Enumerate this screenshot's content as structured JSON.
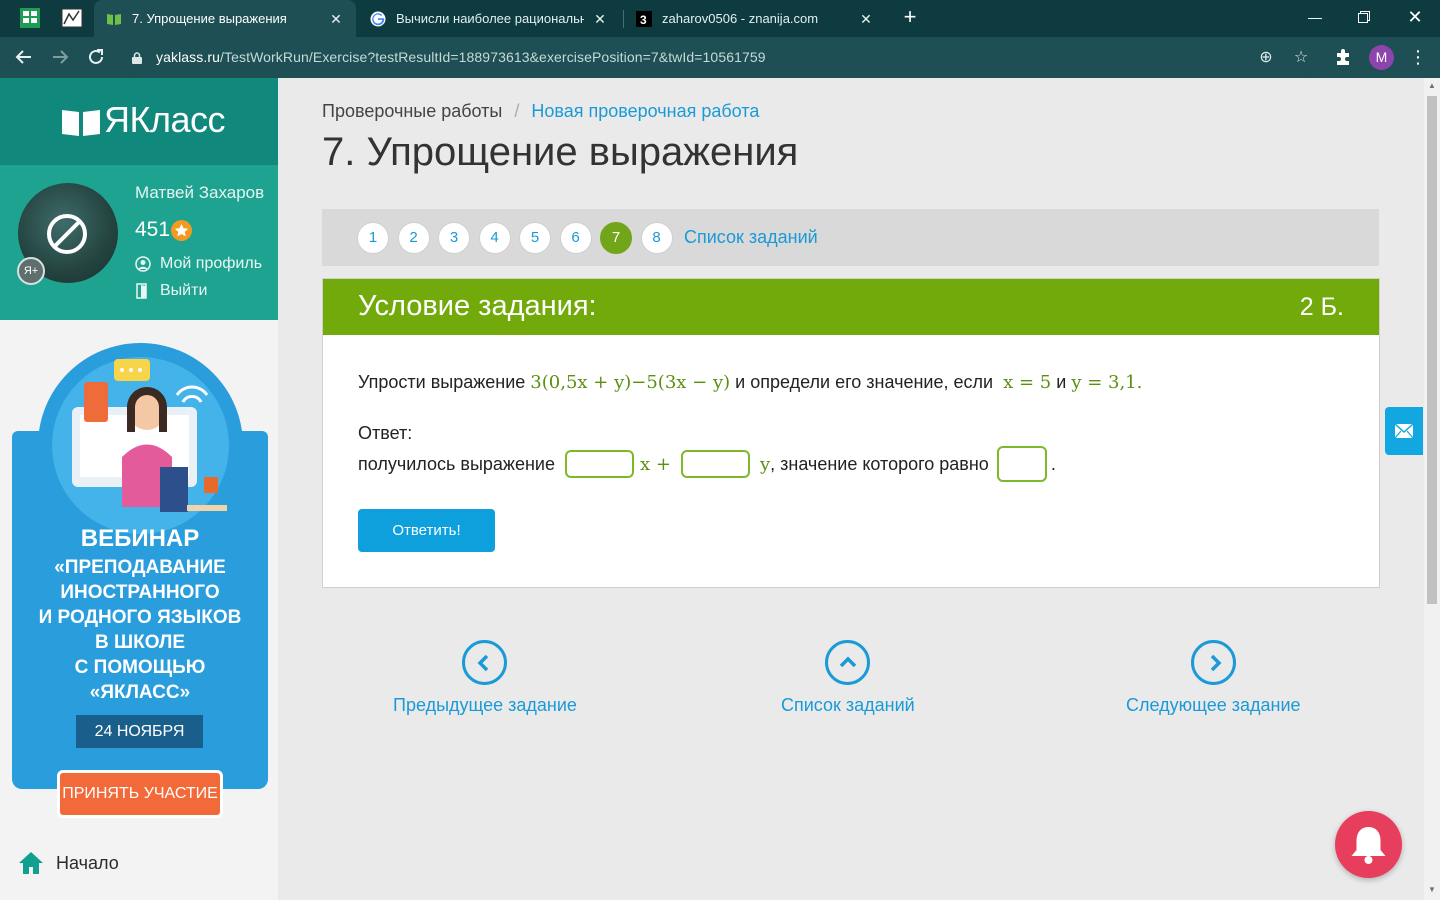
{
  "browser": {
    "tabs": [
      {
        "title": "7. Упрощение выражения",
        "active": true
      },
      {
        "title": "Вычисли наиболее рациональн",
        "active": false
      },
      {
        "title": "zaharov0506 - znanija.com",
        "active": false
      }
    ],
    "url_host": "yaklass.ru",
    "url_path": "/TestWorkRun/Exercise?testResultId=188973613&exercisePosition=7&twId=10561759",
    "profile_initial": "M",
    "colors": {
      "tabbar": "#0d3b3f",
      "toolbar": "#1d4f54"
    }
  },
  "sidebar": {
    "brand": "ЯКласс",
    "user_name": "Матвей Захаров",
    "points": "451",
    "profile_link": "Мой профиль",
    "logout_link": "Выйти",
    "promo": {
      "heading": "ВЕБИНАР",
      "lines": [
        "«ПРЕПОДАВАНИЕ",
        "ИНОСТРАННОГО",
        "И РОДНОГО ЯЗЫКОВ",
        "В ШКОЛЕ",
        "С ПОМОЩЬЮ",
        "«ЯКЛАСС»"
      ],
      "date": "24 НОЯБРЯ",
      "cta": "ПРИНЯТЬ УЧАСТИЕ"
    },
    "nav_home": "Начало",
    "colors": {
      "logo_bg": "#11887c",
      "profile_bg": "#1fa391"
    }
  },
  "main": {
    "breadcrumb_root": "Проверочные работы",
    "breadcrumb_sep": "/",
    "breadcrumb_current": "Новая проверочная работа",
    "title": "7. Упрощение выражения",
    "pager": {
      "numbers": [
        "1",
        "2",
        "3",
        "4",
        "5",
        "6",
        "7",
        "8"
      ],
      "active": "7",
      "list_label": "Список заданий"
    },
    "task": {
      "header": "Условие задания:",
      "points": "2 Б.",
      "q_prefix": "Упрости выражение",
      "expr": "3(0,5x + y)−5(3x − y)",
      "q_middle": "и определи его значение, если",
      "cond_x": "x = 5",
      "q_and": "и",
      "cond_y": "y = 3,1",
      "q_end": ".",
      "answer_label": "Ответ:",
      "answer_prefix": "получилось выражение",
      "answer_x": "x +",
      "answer_y": "y",
      "answer_suffix": ", значение которого равно",
      "answer_end": ".",
      "submit_label": "Ответить!",
      "colors": {
        "header": "#72aa0b",
        "math": "#5a8f10"
      }
    },
    "bottom_nav": {
      "prev": "Предыдущее задание",
      "list": "Список заданий",
      "next": "Следующее задание"
    }
  }
}
